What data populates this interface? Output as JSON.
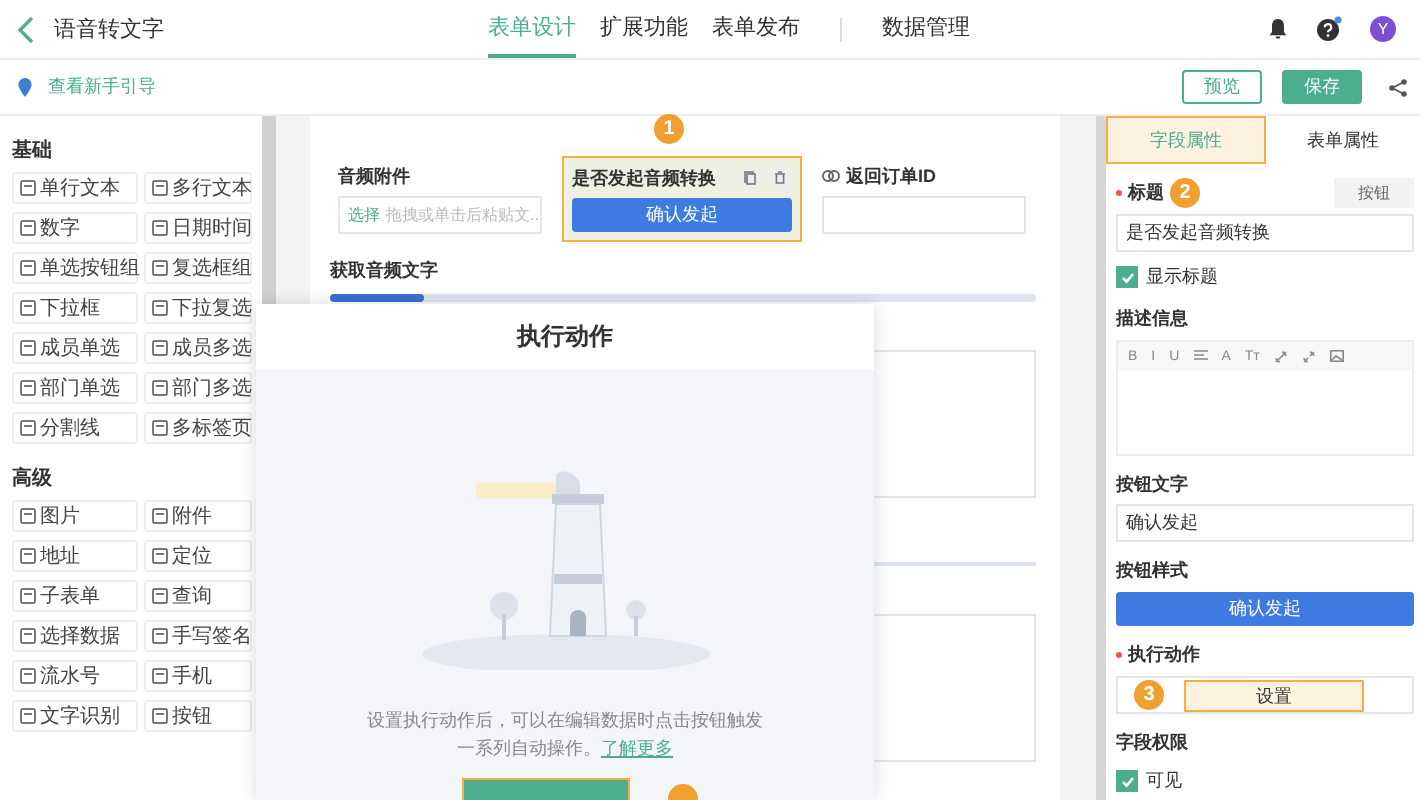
{
  "header": {
    "title": "语音转文字",
    "tabs": [
      {
        "label": "表单设计",
        "selected": true
      },
      {
        "label": "扩展功能",
        "selected": false
      },
      {
        "label": "表单发布",
        "selected": false
      },
      {
        "label": "数据管理",
        "selected": false
      }
    ],
    "avatar": "Y"
  },
  "toolbar": {
    "guide_link": "查看新手引导",
    "buttons": [
      {
        "label": "预览",
        "kind": "outline"
      },
      {
        "label": "保存",
        "kind": "primary"
      }
    ]
  },
  "palette": {
    "sections": [
      {
        "title": "基础",
        "items": [
          "单行文本",
          "多行文本",
          "数字",
          "日期时间",
          "单选按钮组",
          "复选框组",
          "下拉框",
          "下拉复选",
          "成员单选",
          "成员多选",
          "部门单选",
          "部门多选",
          "分割线",
          "多标签页"
        ]
      },
      {
        "title": "高级",
        "items": [
          "图片",
          "附件",
          "地址",
          "定位",
          "子表单",
          "查询",
          "选择数据",
          "手写签名",
          "流水号",
          "手机",
          "文字识别",
          "按钮"
        ]
      }
    ]
  },
  "canvas": {
    "fields": [
      {
        "kind": "upload",
        "label": "音频附件",
        "action": "选择",
        "placeholder": "拖拽或单击后粘贴文...",
        "selected": false
      },
      {
        "kind": "button",
        "label": "是否发起音频转换",
        "button": "确认发起",
        "selected": true,
        "badge": "1"
      },
      {
        "kind": "text",
        "label": "返回订单ID",
        "selected": false
      }
    ],
    "section_label": "获取音频文字"
  },
  "modal": {
    "title": "执行动作",
    "text": "设置执行动作后，可以在编辑数据时点击按钮触发一系列自动操作。",
    "link": "了解更多"
  },
  "properties": {
    "tabs": [
      {
        "label": "字段属性",
        "selected": true
      },
      {
        "label": "表单属性",
        "selected": false
      }
    ],
    "title_label": "标题",
    "title_badge": "2",
    "type_tag": "按钮",
    "title_value": "是否发起音频转换",
    "show_title": {
      "label": "显示标题",
      "checked": true
    },
    "description_label": "描述信息",
    "editor_tools": [
      {
        "kind": "text",
        "label": "B"
      },
      {
        "kind": "text",
        "label": "I"
      },
      {
        "kind": "text",
        "label": "U"
      },
      {
        "kind": "align"
      },
      {
        "kind": "text",
        "label": "A"
      },
      {
        "kind": "text",
        "label": "Tт"
      },
      {
        "kind": "link"
      },
      {
        "kind": "unlink"
      },
      {
        "kind": "image"
      }
    ],
    "button_text_label": "按钮文字",
    "button_text_value": "确认发起",
    "button_style_label": "按钮样式",
    "button_style_preview": "确认发起",
    "action_label": "执行动作",
    "action_badge": "3",
    "action_button": "设置",
    "permission_label": "字段权限",
    "visible": {
      "label": "可见",
      "checked": true
    }
  }
}
